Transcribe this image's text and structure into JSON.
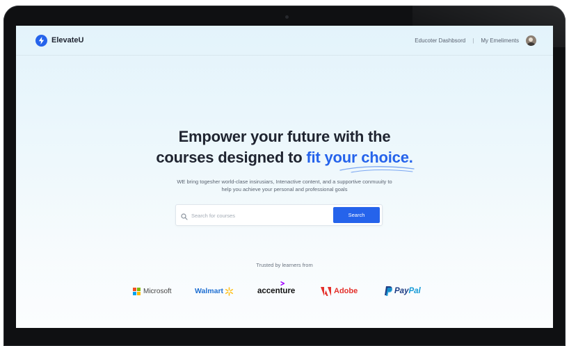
{
  "header": {
    "brand": "ElevateU",
    "nav_items": [
      {
        "label": "Educoter Dashbsord"
      },
      {
        "label": "My Emeliments"
      }
    ],
    "separator": "|"
  },
  "hero": {
    "headline_line1": "Empower your future with the",
    "headline_line2_prefix": "courses designed to ",
    "headline_line2_accent": "fit your choice.",
    "subtext_line1": "WE bring togesher world-clase insirusiars, Intenactive content, and a supportive conmuuity to",
    "subtext_line2": "help you achieve your personal and professional goals"
  },
  "search": {
    "placeholder": "Search for courses",
    "value": "",
    "button_label": "Search"
  },
  "trusted": {
    "label": "Trusted by learners from",
    "logos": [
      {
        "name": "Microsoft"
      },
      {
        "name": "Walmart"
      },
      {
        "name": "accenture"
      },
      {
        "name": "Adobe"
      },
      {
        "name": "PayPal",
        "part1": "Pay",
        "part2": "Pal"
      }
    ]
  },
  "colors": {
    "accent": "#2563eb",
    "heading": "#1f2430",
    "adobe_red": "#e4302b",
    "walmart_blue": "#1f6fd2",
    "walmart_spark": "#ffc220",
    "paypal_dark": "#1d3c84",
    "paypal_light": "#169bd7"
  },
  "icons": [
    "bolt-icon",
    "avatar",
    "search-icon",
    "microsoft-logo",
    "walmart-spark-icon",
    "accenture-mark-icon",
    "adobe-logo-icon",
    "paypal-p-icon"
  ]
}
